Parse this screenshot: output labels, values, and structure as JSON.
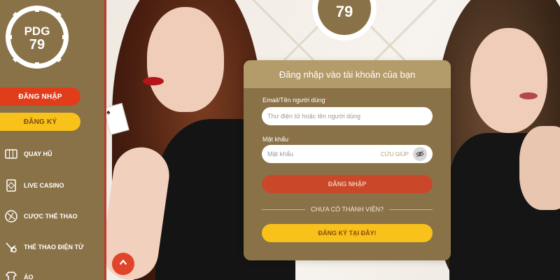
{
  "brand": {
    "logo_text": "PDG 79"
  },
  "sidebar": {
    "login_label": "ĐĂNG NHẬP",
    "register_label": "ĐĂNG KÝ",
    "items": [
      {
        "label": "QUAY HŨ",
        "icon": "slot-machine-icon"
      },
      {
        "label": "LIVE CASINO",
        "icon": "card-icon"
      },
      {
        "label": "CƯỢC THỂ THAO",
        "icon": "football-icon"
      },
      {
        "label": "THỂ THAO ĐIỆN TỬ",
        "icon": "gamepad-icon"
      },
      {
        "label": "ÁO",
        "icon": "shirt-icon"
      }
    ]
  },
  "login_card": {
    "title": "Đăng nhập vào tài khoản của bạn",
    "username": {
      "label": "Email/Tên người dùng",
      "required_mark": "*",
      "placeholder": "Thư điện tử hoặc tên người dùng",
      "value": ""
    },
    "password": {
      "label": "Mật khẩu",
      "required_mark": "*",
      "placeholder": "Mật khẩu",
      "value": "",
      "help_label": "CỨU GIÚP"
    },
    "submit_label": "ĐĂNG NHẬP",
    "divider_text": "CHƯA CÓ THÀNH VIÊN?",
    "register_label": "ĐĂNG KÝ TẠI ĐÂY!"
  },
  "colors": {
    "panel": "#8a7248",
    "card_header": "#b39b6a",
    "login_red": "#e23d1a",
    "register_yellow": "#f8c21a"
  },
  "icons": {
    "scroll_top": "chevron-up-icon",
    "password_toggle": "eye-icon"
  }
}
